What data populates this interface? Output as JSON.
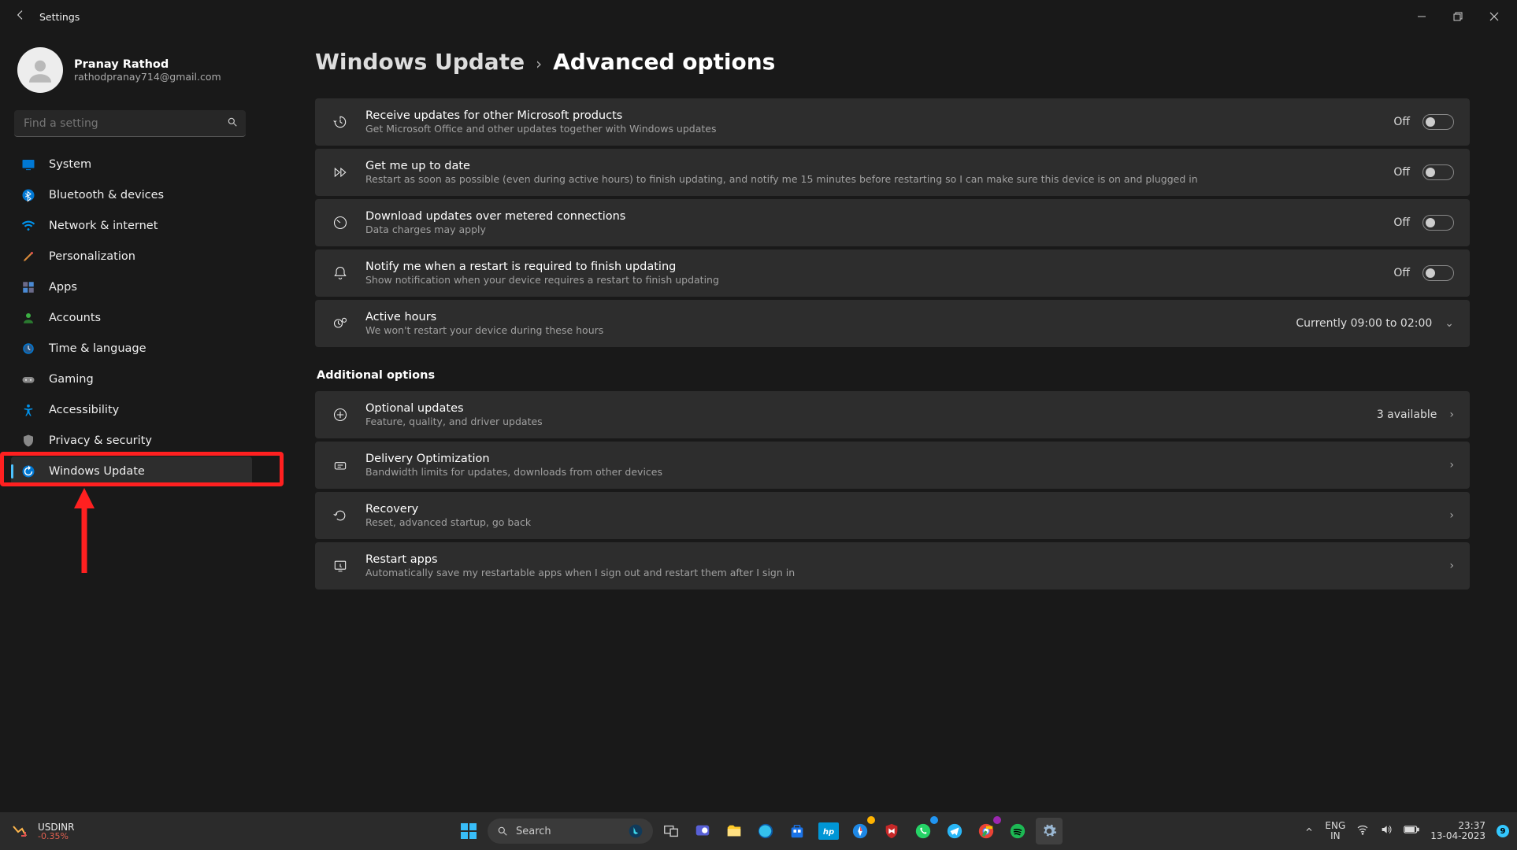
{
  "titlebar": {
    "title": "Settings"
  },
  "profile": {
    "name": "Pranay Rathod",
    "email": "rathodpranay714@gmail.com"
  },
  "search": {
    "placeholder": "Find a setting"
  },
  "sidebar": {
    "items": [
      {
        "label": "System"
      },
      {
        "label": "Bluetooth & devices"
      },
      {
        "label": "Network & internet"
      },
      {
        "label": "Personalization"
      },
      {
        "label": "Apps"
      },
      {
        "label": "Accounts"
      },
      {
        "label": "Time & language"
      },
      {
        "label": "Gaming"
      },
      {
        "label": "Accessibility"
      },
      {
        "label": "Privacy & security"
      },
      {
        "label": "Windows Update"
      }
    ]
  },
  "breadcrumb": {
    "parent": "Windows Update",
    "current": "Advanced options"
  },
  "options": [
    {
      "title": "Receive updates for other Microsoft products",
      "sub": "Get Microsoft Office and other updates together with Windows updates",
      "state": "Off",
      "type": "toggle"
    },
    {
      "title": "Get me up to date",
      "sub": "Restart as soon as possible (even during active hours) to finish updating, and notify me 15 minutes before restarting so I can make sure this device is on and plugged in",
      "state": "Off",
      "type": "toggle"
    },
    {
      "title": "Download updates over metered connections",
      "sub": "Data charges may apply",
      "state": "Off",
      "type": "toggle"
    },
    {
      "title": "Notify me when a restart is required to finish updating",
      "sub": "Show notification when your device requires a restart to finish updating",
      "state": "Off",
      "type": "toggle"
    },
    {
      "title": "Active hours",
      "sub": "We won't restart your device during these hours",
      "tail": "Currently 09:00 to 02:00",
      "type": "expand"
    }
  ],
  "section2_title": "Additional options",
  "additional": [
    {
      "title": "Optional updates",
      "sub": "Feature, quality, and driver updates",
      "tail": "3 available",
      "type": "nav"
    },
    {
      "title": "Delivery Optimization",
      "sub": "Bandwidth limits for updates, downloads from other devices",
      "type": "nav"
    },
    {
      "title": "Recovery",
      "sub": "Reset, advanced startup, go back",
      "type": "nav"
    },
    {
      "title": "Restart apps",
      "sub": "Automatically save my restartable apps when I sign out and restart them after I sign in",
      "type": "nav"
    }
  ],
  "taskbar": {
    "widget": {
      "l1": "USDINR",
      "l2": "-0.35%"
    },
    "search": "Search",
    "lang": {
      "l1": "ENG",
      "l2": "IN"
    },
    "clock": {
      "time": "23:37",
      "date": "13-04-2023"
    },
    "notif": "9"
  }
}
